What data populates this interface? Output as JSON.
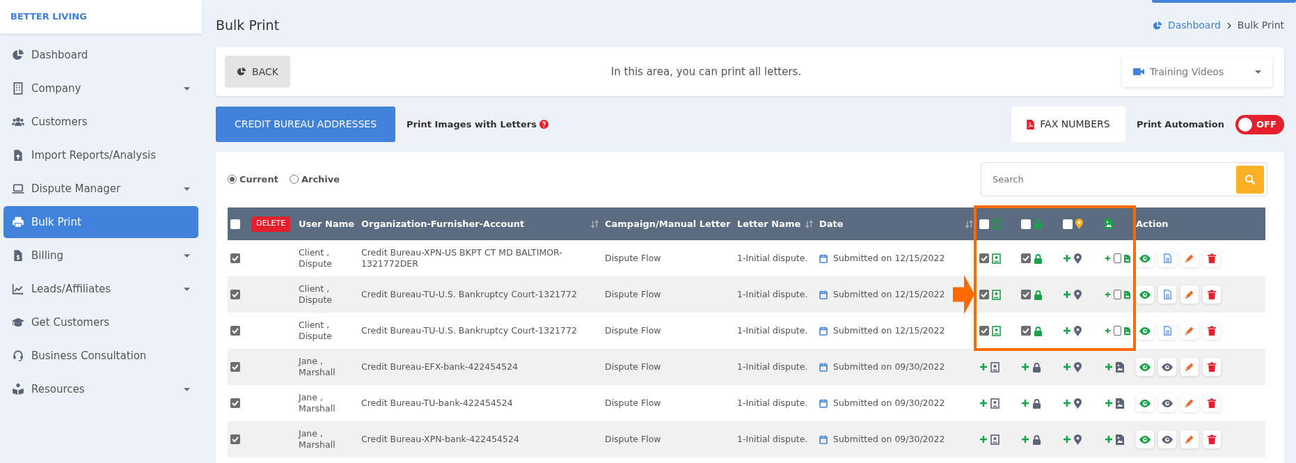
{
  "brand": "BETTER LIVING",
  "sidebar": {
    "items": [
      {
        "label": "Dashboard",
        "selected": false,
        "expandable": false
      },
      {
        "label": "Company",
        "selected": false,
        "expandable": true
      },
      {
        "label": "Customers",
        "selected": false,
        "expandable": false
      },
      {
        "label": "Import Reports/Analysis",
        "selected": false,
        "expandable": false
      },
      {
        "label": "Dispute Manager",
        "selected": false,
        "expandable": true
      },
      {
        "label": "Bulk Print",
        "selected": true,
        "expandable": false
      },
      {
        "label": "Billing",
        "selected": false,
        "expandable": true
      },
      {
        "label": "Leads/Affiliates",
        "selected": false,
        "expandable": true
      },
      {
        "label": "Get Customers",
        "selected": false,
        "expandable": false
      },
      {
        "label": "Business Consultation",
        "selected": false,
        "expandable": false
      },
      {
        "label": "Resources",
        "selected": false,
        "expandable": true
      }
    ]
  },
  "page_title": "Bulk Print",
  "breadcrumb": [
    {
      "label": "Dashboard"
    },
    {
      "label": "Bulk Print"
    }
  ],
  "info_bar": {
    "back_button": "BACK",
    "message": "In this area, you can print all letters.",
    "dropdown": "Training Videos"
  },
  "toolbar": {
    "primary_button": "CREDIT BUREAU ADDRESSES",
    "print_images_label": "Print Images with Letters",
    "fax_button": "FAX NUMBERS",
    "automation_label": "Print Automation",
    "automation": {
      "on": false,
      "label": "OFF"
    }
  },
  "filters": [
    {
      "label": "Current",
      "selected": true
    },
    {
      "label": "Archive",
      "selected": false
    }
  ],
  "search": {
    "placeholder": "Search"
  },
  "table": {
    "select_all": false,
    "delete_button": "DELETE",
    "columns": [
      "User Name",
      "Organization-Furnisher-Account",
      "Campaign/Manual Letter",
      "Letter Name",
      "Date"
    ],
    "flag_headers": [
      {
        "kind": "box",
        "checked": false
      },
      {
        "kind": "box",
        "checked": false
      },
      {
        "kind": "box",
        "checked": false
      },
      {
        "kind": "icon"
      }
    ],
    "action_header": "Action",
    "rows": [
      {
        "selected": true,
        "user": [
          "Client ,",
          "Dispute"
        ],
        "account": "Credit Bureau-XPN-US BKPT CT MD BALTIMOR-1321772DER",
        "campaign": "Dispute Flow",
        "letter": "1-Initial dispute.",
        "date": "Submitted on 12/15/2022",
        "flags": [
          {
            "kind": "box",
            "checked": true
          },
          {
            "kind": "box",
            "checked": true
          },
          {
            "kind": "plus"
          },
          {
            "kind": "plus-box",
            "checked": false
          }
        ],
        "letter_ready": true
      },
      {
        "selected": true,
        "user": [
          "Client ,",
          "Dispute"
        ],
        "account": "Credit Bureau-TU-U.S. Bankruptcy Court-1321772",
        "campaign": "Dispute Flow",
        "letter": "1-Initial dispute.",
        "date": "Submitted on 12/15/2022",
        "flags": [
          {
            "kind": "box",
            "checked": true
          },
          {
            "kind": "box",
            "checked": true
          },
          {
            "kind": "plus"
          },
          {
            "kind": "plus-box",
            "checked": false
          }
        ],
        "letter_ready": true
      },
      {
        "selected": true,
        "user": [
          "Client ,",
          "Dispute"
        ],
        "account": "Credit Bureau-TU-U.S. Bankruptcy Court-1321772",
        "campaign": "Dispute Flow",
        "letter": "1-Initial dispute.",
        "date": "Submitted on 12/15/2022",
        "flags": [
          {
            "kind": "box",
            "checked": true
          },
          {
            "kind": "box",
            "checked": true
          },
          {
            "kind": "plus"
          },
          {
            "kind": "plus-box",
            "checked": false
          }
        ],
        "letter_ready": true
      },
      {
        "selected": true,
        "user": [
          "Jane ,",
          "Marshall"
        ],
        "account": "Credit Bureau-EFX-bank-422454524",
        "campaign": "Dispute Flow",
        "letter": "1-Initial dispute.",
        "date": "Submitted on 09/30/2022",
        "flags": [
          {
            "kind": "plus"
          },
          {
            "kind": "plus"
          },
          {
            "kind": "plus"
          },
          {
            "kind": "plus"
          }
        ],
        "letter_ready": false
      },
      {
        "selected": true,
        "user": [
          "Jane ,",
          "Marshall"
        ],
        "account": "Credit Bureau-TU-bank-422454524",
        "campaign": "Dispute Flow",
        "letter": "1-Initial dispute.",
        "date": "Submitted on 09/30/2022",
        "flags": [
          {
            "kind": "plus"
          },
          {
            "kind": "plus"
          },
          {
            "kind": "plus"
          },
          {
            "kind": "plus"
          }
        ],
        "letter_ready": false
      },
      {
        "selected": true,
        "user": [
          "Jane ,",
          "Marshall"
        ],
        "account": "Credit Bureau-XPN-bank-422454524",
        "campaign": "Dispute Flow",
        "letter": "1-Initial dispute.",
        "date": "Submitted on 09/30/2022",
        "flags": [
          {
            "kind": "plus"
          },
          {
            "kind": "plus"
          },
          {
            "kind": "plus"
          },
          {
            "kind": "plus"
          }
        ],
        "letter_ready": false
      }
    ]
  }
}
